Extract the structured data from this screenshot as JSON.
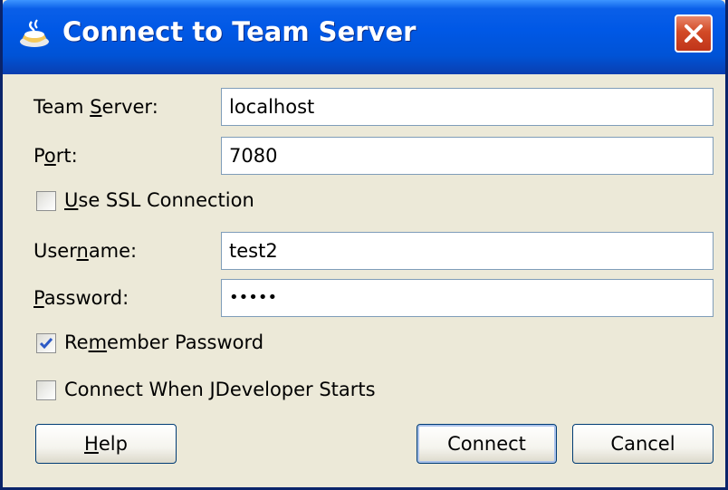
{
  "window": {
    "title": "Connect to Team Server",
    "close_icon": "close-icon",
    "app_icon": "java-coffee-cup-icon"
  },
  "form": {
    "team_server": {
      "label_pre": "Team ",
      "label_u": "S",
      "label_post": "erver:",
      "value": "localhost"
    },
    "port": {
      "label_pre": "P",
      "label_u": "o",
      "label_post": "rt:",
      "value": "7080"
    },
    "use_ssl": {
      "label_pre": "",
      "label_u": "U",
      "label_post": "se SSL Connection",
      "checked": false
    },
    "username": {
      "label_pre": "User",
      "label_u": "n",
      "label_post": "ame:",
      "value": "test2"
    },
    "password": {
      "label_pre": "",
      "label_u": "P",
      "label_post": "assword:",
      "value": "•••••"
    },
    "remember_password": {
      "label_pre": "Re",
      "label_u": "m",
      "label_post": "ember Password",
      "checked": true
    },
    "connect_on_start": {
      "label": "Connect When JDeveloper Starts",
      "checked": false
    }
  },
  "buttons": {
    "help_pre": "",
    "help_u": "H",
    "help_post": "elp",
    "connect": "Connect",
    "cancel": "Cancel"
  },
  "colors": {
    "titlebar": "#0058e6",
    "dialog_bg": "#ece9d8",
    "close_btn": "#c0351a",
    "check_mark": "#2d5ac5"
  }
}
